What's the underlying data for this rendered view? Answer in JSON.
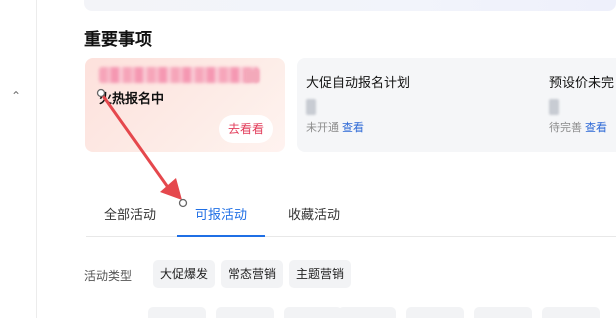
{
  "sidebar": {
    "collapse_icon": "chevron-up-icon",
    "collapse_glyph": "⌃"
  },
  "section": {
    "title": "重要事项"
  },
  "hot_card": {
    "status_label": "火热报名中",
    "action_label": "去看看",
    "accent_color": "#e23d5b"
  },
  "plans": [
    {
      "title": "大促自动报名计划",
      "status": "未开通",
      "link": "查看"
    },
    {
      "title": "预设价未完",
      "status": "待完善",
      "link": "查看"
    }
  ],
  "tabs": [
    {
      "label": "全部活动",
      "active": false
    },
    {
      "label": "可报活动",
      "active": true
    },
    {
      "label": "收藏活动",
      "active": false
    }
  ],
  "filter": {
    "label": "活动类型",
    "options": [
      "大促爆发",
      "常态营销",
      "主题营销"
    ]
  },
  "colors": {
    "link": "#2c68d6",
    "active_tab": "#1f6fe5",
    "annotation_arrow": "#e5484d"
  }
}
